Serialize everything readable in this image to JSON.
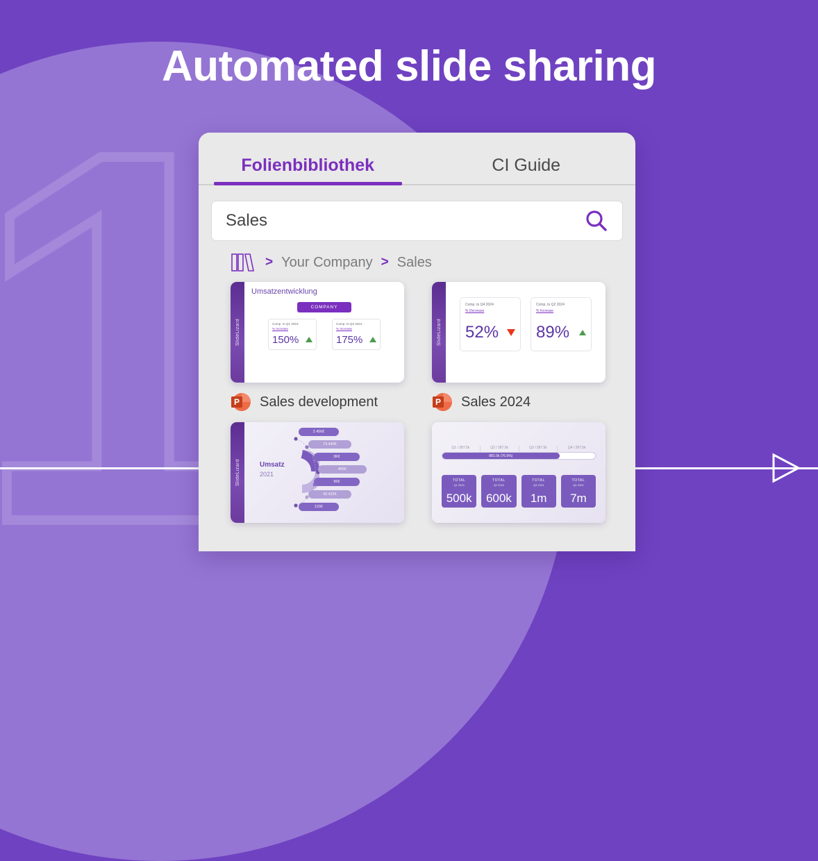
{
  "page": {
    "title": "Automated slide sharing",
    "accent": "#7b2fbe",
    "background": "#6f42c1",
    "background_blob": "#9575d4",
    "numeral_watermark": "1"
  },
  "app": {
    "tabs": [
      {
        "label": "Folienbibliothek",
        "active": true
      },
      {
        "label": "CI Guide",
        "active": false
      }
    ],
    "search": {
      "value": "Sales",
      "placeholder": "Search",
      "icon": "search-icon"
    },
    "breadcrumb": {
      "icon": "library-books-icon",
      "separator": ">",
      "items": [
        "Your Company",
        "Sales"
      ]
    },
    "slides": [
      {
        "file_name": "Sales development",
        "file_icon": "powerpoint-icon",
        "rail_brand": "SlideLizard",
        "title": "Umsatzentwicklung",
        "badge": "COMPANY",
        "stats": [
          {
            "caption": "Comp. to Q1 2023",
            "sub": "% Increase",
            "value": "150%",
            "trend": "up"
          },
          {
            "caption": "Comp. to Q2 2022",
            "sub": "% Increase",
            "value": "175%",
            "trend": "up"
          }
        ]
      },
      {
        "file_name": "Sales 2024",
        "file_icon": "powerpoint-icon",
        "rail_brand": "SlideLizard",
        "stats": [
          {
            "caption": "Comp. to Q4 2024",
            "sub": "% Decrease",
            "value": "52%",
            "trend": "down"
          },
          {
            "caption": "Comp. to Q2 2024",
            "sub": "% Increase",
            "value": "89%",
            "trend": "up"
          }
        ]
      },
      {
        "rail_brand": "SlideLizard",
        "label": "Umsatz",
        "sublabel": "2021",
        "pills": [
          "2.456€",
          "74.440€",
          "3K€",
          "455€",
          "90€",
          "42.432€",
          "120€"
        ]
      },
      {
        "rail_brand": "SlideLizard",
        "ticks": [
          "Q1 / 287.5k",
          "Q2 / 287.5k",
          "Q3 / 287.5k",
          "Q4 / 287.5k"
        ],
        "bar_label": "881.0k (76.6%)",
        "bar_percent": 76.6,
        "totals": [
          {
            "label": "TOTAL",
            "sub": "Q1 2024",
            "value": "500k"
          },
          {
            "label": "TOTAL",
            "sub": "Q2 2024",
            "value": "600k"
          },
          {
            "label": "TOTAL",
            "sub": "Q3 2024",
            "value": "1m"
          },
          {
            "label": "TOTAL",
            "sub": "Q4 2024",
            "value": "7m"
          }
        ]
      }
    ]
  }
}
